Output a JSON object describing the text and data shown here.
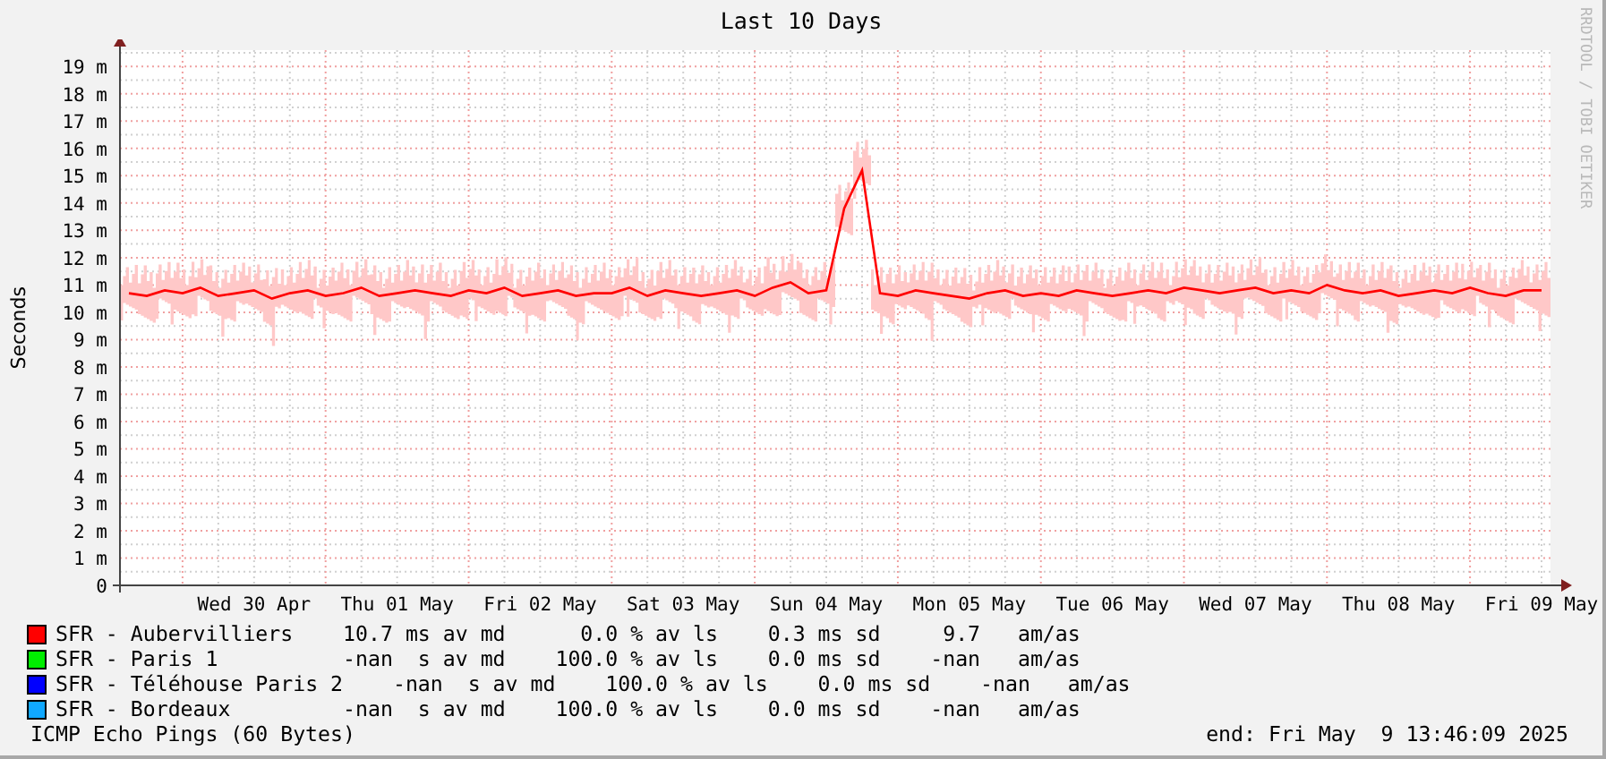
{
  "graph": {
    "title": "Last 10 Days",
    "credit": "RRDTOOL / TOBI OETIKER",
    "chart_data": {
      "type": "line",
      "grid": true,
      "ylabel": "Seconds",
      "ylim": [
        0,
        19.6
      ],
      "categories": [
        null,
        null,
        null,
        null,
        null,
        null,
        null,
        "Wed 30 Apr",
        null,
        null,
        null,
        null,
        null,
        null,
        null,
        "Thu 01 May",
        null,
        null,
        null,
        null,
        null,
        null,
        null,
        "Fri 02 May",
        null,
        null,
        null,
        null,
        null,
        null,
        null,
        "Sat 03 May",
        null,
        null,
        null,
        null,
        null,
        null,
        null,
        "Sun 04 May",
        null,
        null,
        null,
        null,
        null,
        null,
        null,
        "Mon 05 May",
        null,
        null,
        null,
        null,
        null,
        null,
        null,
        "Tue 06 May",
        null,
        null,
        null,
        null,
        null,
        null,
        null,
        "Wed 07 May",
        null,
        null,
        null,
        null,
        null,
        null,
        null,
        "Thu 08 May",
        null,
        null,
        null,
        null,
        null,
        null,
        null,
        "Fri 09 May"
      ],
      "yticks": [
        {
          "value": 0,
          "label": "0"
        },
        {
          "value": 1,
          "label": "1 m"
        },
        {
          "value": 2,
          "label": "2 m"
        },
        {
          "value": 3,
          "label": "3 m"
        },
        {
          "value": 4,
          "label": "4 m"
        },
        {
          "value": 5,
          "label": "5 m"
        },
        {
          "value": 6,
          "label": "6 m"
        },
        {
          "value": 7,
          "label": "7 m"
        },
        {
          "value": 8,
          "label": "8 m"
        },
        {
          "value": 9,
          "label": "9 m"
        },
        {
          "value": 10,
          "label": "10 m"
        },
        {
          "value": 11,
          "label": "11 m"
        },
        {
          "value": 12,
          "label": "12 m"
        },
        {
          "value": 13,
          "label": "13 m"
        },
        {
          "value": 14,
          "label": "14 m"
        },
        {
          "value": 15,
          "label": "15 m"
        },
        {
          "value": 16,
          "label": "16 m"
        },
        {
          "value": 17,
          "label": "17 m"
        },
        {
          "value": 18,
          "label": "18 m"
        },
        {
          "value": 19,
          "label": "19 m"
        }
      ],
      "series": [
        {
          "name": "SFR - Aubervilliers",
          "color": "#ff0000",
          "values": [
            10.7,
            10.6,
            10.8,
            10.7,
            10.9,
            10.6,
            10.7,
            10.8,
            10.5,
            10.7,
            10.8,
            10.6,
            10.7,
            10.9,
            10.6,
            10.7,
            10.8,
            10.7,
            10.6,
            10.8,
            10.7,
            10.9,
            10.6,
            10.7,
            10.8,
            10.6,
            10.7,
            10.7,
            10.9,
            10.6,
            10.8,
            10.7,
            10.6,
            10.7,
            10.8,
            10.6,
            10.9,
            11.1,
            10.7,
            10.8,
            13.8,
            15.2,
            10.7,
            10.6,
            10.8,
            10.7,
            10.6,
            10.5,
            10.7,
            10.8,
            10.6,
            10.7,
            10.6,
            10.8,
            10.7,
            10.6,
            10.7,
            10.8,
            10.7,
            10.9,
            10.8,
            10.7,
            10.8,
            10.9,
            10.7,
            10.8,
            10.7,
            11.0,
            10.8,
            10.7,
            10.8,
            10.6,
            10.7,
            10.8,
            10.7,
            10.9,
            10.7,
            10.6,
            10.8,
            10.8
          ]
        }
      ]
    }
  },
  "legend": [
    {
      "stats": "    10.7 ms av md      0.0 % av ls    0.3 ms sd     9.7   am/as"
    },
    {
      "name": "SFR - Paris 1",
      "color": "#00ee00",
      "stats": "          -nan  s av md    100.0 % av ls    0.0 ms sd    -nan   am/as"
    },
    {
      "name": "SFR - Téléhouse Paris 2",
      "color": "#0000ff",
      "stats": "    -nan  s av md    100.0 % av ls    0.0 ms sd    -nan   am/as"
    },
    {
      "name": "SFR - Bordeaux",
      "color": "#10a8ff",
      "stats": "         -nan  s av md    100.0 % av ls    0.0 ms sd    -nan   am/as"
    }
  ],
  "footer": {
    "caption": "ICMP Echo Pings (60 Bytes)",
    "end": "end: Fri May  9 13:46:09 2025"
  }
}
